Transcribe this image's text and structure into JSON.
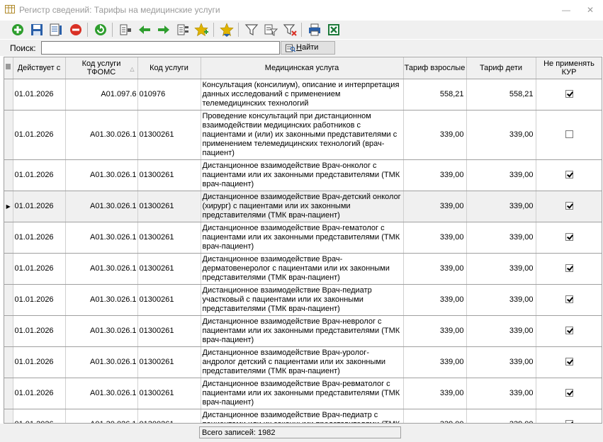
{
  "window": {
    "title": "Регистр сведений: Тарифы на медицинские услуги",
    "minimize": "—",
    "close": "✕"
  },
  "toolbar": {
    "buttons": [
      {
        "icon": "add-icon",
        "color": "#2e9e2e"
      },
      {
        "icon": "save-icon",
        "color": "#2a5fa8"
      },
      {
        "icon": "properties-icon",
        "color": "#2a5fa8"
      },
      {
        "icon": "delete-icon",
        "color": "#d93025"
      },
      {
        "icon": "refresh-icon",
        "color": "#2e9e2e"
      },
      {
        "icon": "columns-icon",
        "color": "#555555"
      },
      {
        "icon": "arrow-left-icon",
        "color": "#2e9e2e"
      },
      {
        "icon": "arrow-right-icon",
        "color": "#2e9e2e"
      },
      {
        "icon": "list-icon",
        "color": "#555555"
      },
      {
        "icon": "star-add-icon",
        "color": "#e0b400"
      },
      {
        "icon": "star-down-icon",
        "color": "#e0b400"
      },
      {
        "icon": "filter-icon",
        "color": "#555555"
      },
      {
        "icon": "filter-edit-icon",
        "color": "#555555"
      },
      {
        "icon": "filter-clear-icon",
        "color": "#d93025"
      },
      {
        "icon": "print-icon",
        "color": "#2a5fa8"
      },
      {
        "icon": "excel-icon",
        "color": "#1d7a3a"
      }
    ]
  },
  "search": {
    "label": "Поиск:",
    "value": "",
    "button_prefix": "",
    "button_underlined": "Н",
    "button_rest": "айти"
  },
  "grid": {
    "headers": {
      "valid_from": "Действует с",
      "code_tfoms": "Код услуги ТФОМС",
      "code": "Код услуги",
      "service": "Медицинская услуга",
      "tariff_adult": "Тариф взрослые",
      "tariff_child": "Тариф дети",
      "no_kur": "Не применять КУР"
    },
    "rows": [
      {
        "valid_from": "01.01.2026",
        "code_tfoms": "A01.097.6",
        "code": "010976",
        "service": "Консультация (консилиум), описание  и интерпретация данных исследований с применением телемедицинских технологий",
        "tariff_adult": "558,21",
        "tariff_child": "558,21",
        "no_kur": true,
        "current": false,
        "tall": false
      },
      {
        "valid_from": "01.01.2026",
        "code_tfoms": "A01.30.026.1",
        "code": "01300261",
        "service": "Проведение консультаций при дистанционном взаимодействии медицинских работников с пациентами и (или) их законными представителями с применением телемедицинских технологий (врач-пациент)",
        "tariff_adult": "339,00",
        "tariff_child": "339,00",
        "no_kur": false,
        "current": false,
        "tall": true
      },
      {
        "valid_from": "01.01.2026",
        "code_tfoms": "A01.30.026.1",
        "code": "01300261",
        "service": "Дистанционное взаимодействие Врач-онколог с пациентами или их законными представителями (ТМК врач-пациент)",
        "tariff_adult": "339,00",
        "tariff_child": "339,00",
        "no_kur": true,
        "current": false,
        "tall": false
      },
      {
        "valid_from": "01.01.2026",
        "code_tfoms": "A01.30.026.1",
        "code": "01300261",
        "service": "Дистанционное взаимодействие Врач-детский онколог (хирург) с пациентами или их законными представителями (ТМК врач-пациент)",
        "tariff_adult": "339,00",
        "tariff_child": "339,00",
        "no_kur": true,
        "current": true,
        "tall": false
      },
      {
        "valid_from": "01.01.2026",
        "code_tfoms": "A01.30.026.1",
        "code": "01300261",
        "service": "Дистанционное взаимодействие Врач-гематолог с пациентами или их законными представителями (ТМК врач-пациент)",
        "tariff_adult": "339,00",
        "tariff_child": "339,00",
        "no_kur": true,
        "current": false,
        "tall": false
      },
      {
        "valid_from": "01.01.2026",
        "code_tfoms": "A01.30.026.1",
        "code": "01300261",
        "service": "Дистанционное взаимодействие Врач-дерматовенеролог с пациентами или их законными представителями (ТМК врач-пациент)",
        "tariff_adult": "339,00",
        "tariff_child": "339,00",
        "no_kur": true,
        "current": false,
        "tall": false
      },
      {
        "valid_from": "01.01.2026",
        "code_tfoms": "A01.30.026.1",
        "code": "01300261",
        "service": "Дистанционное взаимодействие Врач-педиатр участковый с пациентами или их законными представителями (ТМК врач-пациент)",
        "tariff_adult": "339,00",
        "tariff_child": "339,00",
        "no_kur": true,
        "current": false,
        "tall": false
      },
      {
        "valid_from": "01.01.2026",
        "code_tfoms": "A01.30.026.1",
        "code": "01300261",
        "service": "Дистанционное взаимодействие Врач-невролог с пациентами или их законными представителями (ТМК врач-пациент)",
        "tariff_adult": "339,00",
        "tariff_child": "339,00",
        "no_kur": true,
        "current": false,
        "tall": false
      },
      {
        "valid_from": "01.01.2026",
        "code_tfoms": "A01.30.026.1",
        "code": "01300261",
        "service": "Дистанционное взаимодействие Врач-уролог-андролог детский с пациентами или их законными представителями (ТМК врач-пациент)",
        "tariff_adult": "339,00",
        "tariff_child": "339,00",
        "no_kur": true,
        "current": false,
        "tall": false
      },
      {
        "valid_from": "01.01.2026",
        "code_tfoms": "A01.30.026.1",
        "code": "01300261",
        "service": "Дистанционное взаимодействие Врач-ревматолог с пациентами или их законными представителями (ТМК врач-пациент)",
        "tariff_adult": "339,00",
        "tariff_child": "339,00",
        "no_kur": true,
        "current": false,
        "tall": false
      },
      {
        "valid_from": "01.01.2026",
        "code_tfoms": "A01.30.026.1",
        "code": "01300261",
        "service": "Дистанционное взаимодействие Врач-педиатр с пациентами или их законными представителями (ТМК врач-пациент)",
        "tariff_adult": "339,00",
        "tariff_child": "339,00",
        "no_kur": true,
        "current": false,
        "tall": false
      }
    ]
  },
  "status": {
    "total_label": "Всего записей: 1982"
  }
}
